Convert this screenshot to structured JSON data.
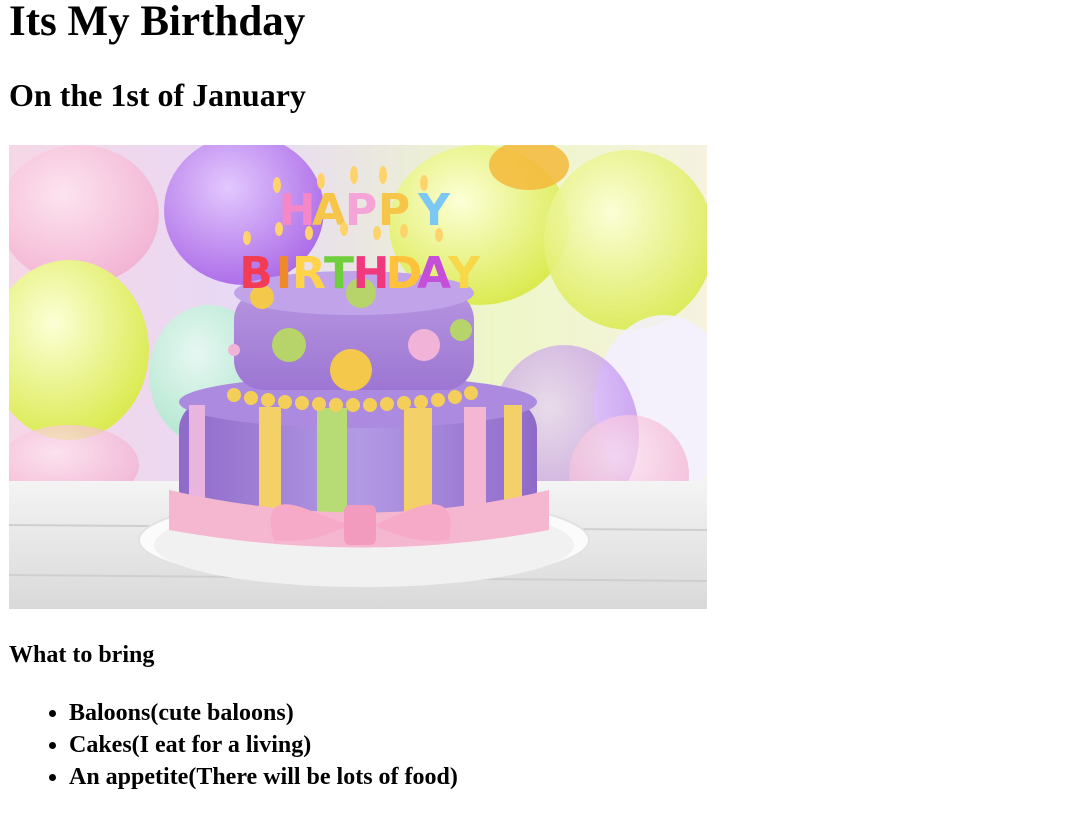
{
  "heading": "Its My Birthday",
  "subheading": "On the 1st of January",
  "image": {
    "description_icon": "birthday-cake-image",
    "candle_letters_line1": "HAPPY",
    "candle_letters_line2": "BIRTHDAY"
  },
  "list_title": "What to bring",
  "items": [
    "Baloons(cute baloons)",
    "Cakes(I eat for a living)",
    "An appetite(There will be lots of food)"
  ]
}
